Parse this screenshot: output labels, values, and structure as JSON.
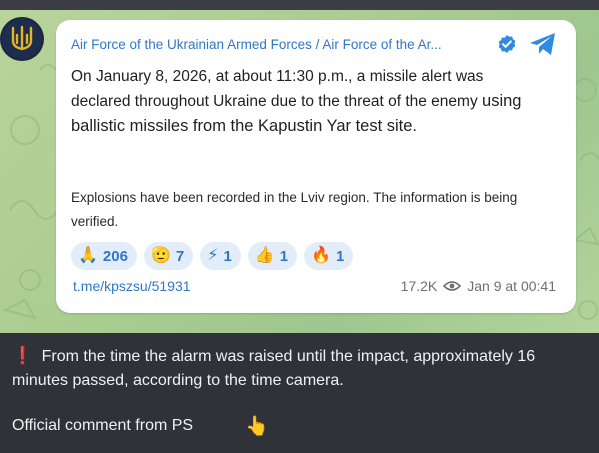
{
  "post": {
    "channel_header": "Air Force of the Ukrainian Armed Forces / Air Force of the Ar...",
    "body_line1": "On January 8, 2026, at about 11:30 p.m., a missile alert was declared throughout Ukraine due to the threat of the enemy",
    "body_line2": "using ballistic missiles from the Kapustin Yar test site.",
    "body_para2": "Explosions have been recorded in the Lviv region. The information is being verified.",
    "reactions": [
      {
        "emoji": "🙏",
        "count": "206"
      },
      {
        "emoji": "🫡",
        "count": "7"
      },
      {
        "emoji": "⚡",
        "count": "1"
      },
      {
        "emoji": "👍",
        "count": "1"
      },
      {
        "emoji": "🔥",
        "count": "1"
      }
    ],
    "link": "t.me/kpszsu/51931",
    "views": "17.2K",
    "date": "Jan 9 at 00:41"
  },
  "caption": {
    "alert_mark": "❗",
    "text": "From the time the alarm was raised until the impact, approximately 16 minutes passed, according to the time camera.",
    "official_comment": "Official comment from PS",
    "pointer": "👆"
  },
  "icons": {
    "avatar": "trident-icon",
    "verified": "verified-badge-icon",
    "telegram": "telegram-logo-icon",
    "views": "eye-icon"
  },
  "colors": {
    "accent": "#2f77c8",
    "verified": "#2f8be0",
    "alert": "#e0312b",
    "dark_bg": "#2f3238"
  }
}
